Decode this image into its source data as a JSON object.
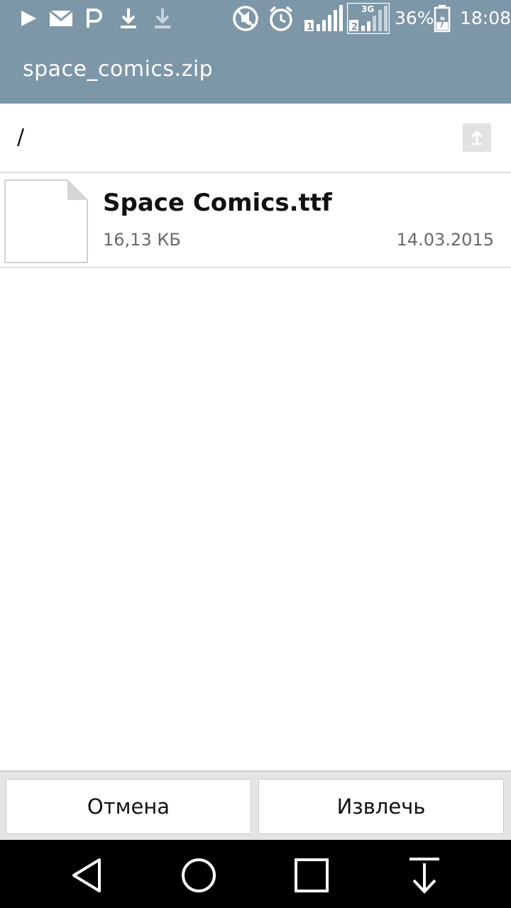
{
  "status_bar": {
    "icons": [
      "play-icon",
      "mail-icon",
      "parking-icon",
      "download-icon",
      "download-pending-icon",
      "mute-icon",
      "alarm-icon",
      "signal-sim1-icon",
      "signal-sim2-3g-icon",
      "battery-charging-icon"
    ],
    "network_type": "3G",
    "battery": "36%",
    "time": "18:08"
  },
  "header": {
    "title": "space_comics.zip"
  },
  "path_bar": {
    "path": "/",
    "up_icon": "up-arrow-icon"
  },
  "files": [
    {
      "name": "Space Comics.ttf",
      "size": "16,13 КБ",
      "date": "14.03.2015",
      "icon": "file-icon"
    }
  ],
  "actions": {
    "cancel_label": "Отмена",
    "extract_label": "Извлечь"
  },
  "nav_bar": {
    "icons": [
      "back-icon",
      "home-icon",
      "recents-icon",
      "notifications-down-icon"
    ]
  },
  "colors": {
    "header_bg": "#7d96a8",
    "nav_bg": "#000000"
  }
}
